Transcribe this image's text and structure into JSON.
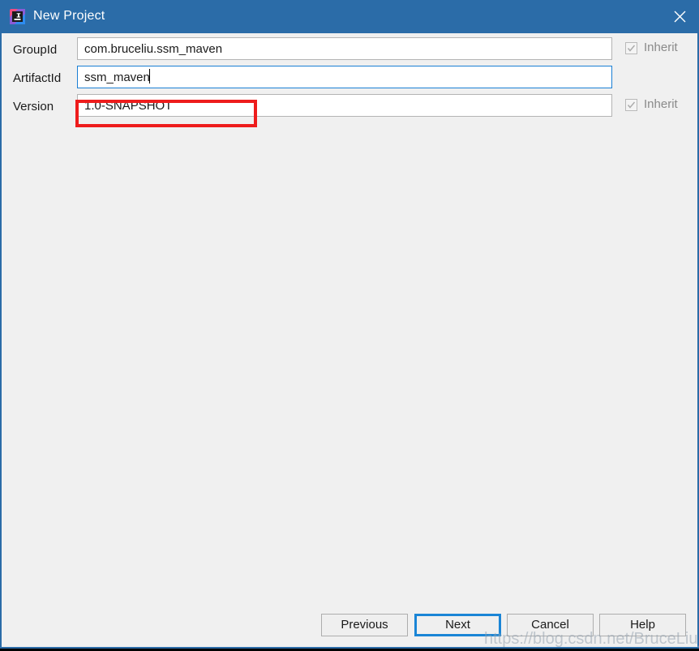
{
  "window": {
    "title": "New Project",
    "app_icon": "intellij-idea-icon",
    "close_icon": "close-icon",
    "titlebar_color": "#2b6ca8",
    "border_color": "#2b6ca8",
    "background_color": "#f0f0f0"
  },
  "form": {
    "fields": [
      {
        "label": "GroupId",
        "value": "com.bruceliu.ssm_maven",
        "focused": false,
        "inherit": {
          "label": "Inherit",
          "checked": true,
          "enabled": false
        }
      },
      {
        "label": "ArtifactId",
        "value": "ssm_maven",
        "focused": true,
        "inherit": null
      },
      {
        "label": "Version",
        "value": "1.0-SNAPSHOT",
        "focused": false,
        "inherit": {
          "label": "Inherit",
          "checked": true,
          "enabled": false
        }
      }
    ]
  },
  "annotation": {
    "color": "#ee1c1c",
    "target": "artifactid-input"
  },
  "buttons": {
    "previous": "Previous",
    "next": "Next",
    "cancel": "Cancel",
    "help": "Help",
    "focus_color": "#1a85d6"
  },
  "watermark": {
    "text": "https://blog.csdn.net/BruceLiu_code"
  }
}
